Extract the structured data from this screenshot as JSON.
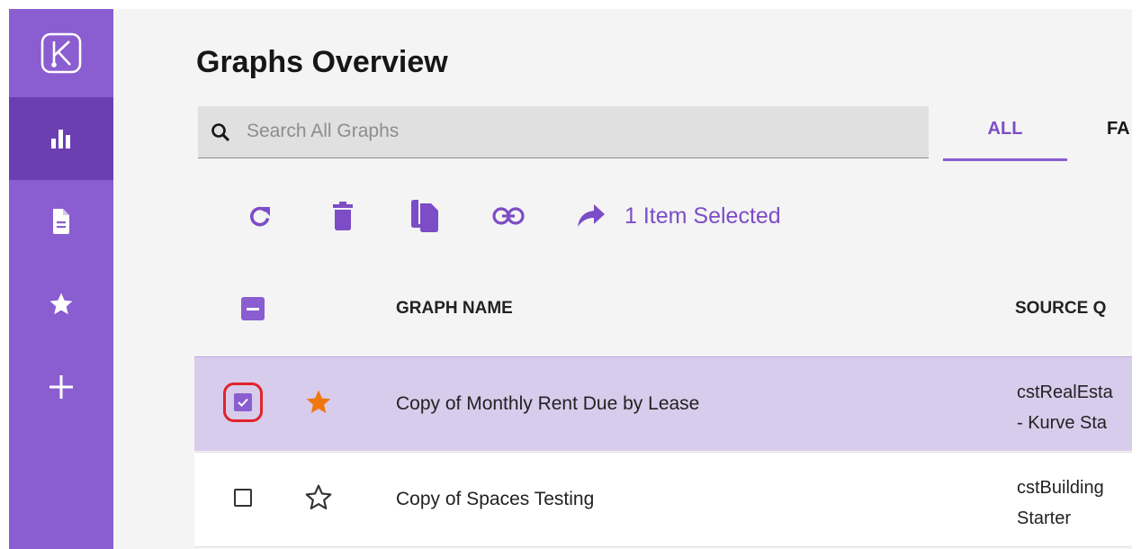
{
  "sidebar": {
    "logo_icon": "kurve-logo-icon",
    "items": [
      {
        "name": "graphs",
        "icon": "bar-chart-icon",
        "active": true
      },
      {
        "name": "documents",
        "icon": "document-icon",
        "active": false
      },
      {
        "name": "favorites",
        "icon": "star-icon",
        "active": false
      },
      {
        "name": "add",
        "icon": "plus-icon",
        "active": false
      }
    ]
  },
  "header": {
    "title": "Graphs Overview"
  },
  "search": {
    "placeholder": "Search All Graphs",
    "value": ""
  },
  "tabs": [
    {
      "label": "ALL",
      "active": true
    },
    {
      "label": "FA",
      "active": false
    }
  ],
  "toolbar": {
    "icons": [
      "refresh-icon",
      "delete-icon",
      "copy-icon",
      "link-icon",
      "share-icon"
    ],
    "selected_label": "1 Item Selected"
  },
  "table": {
    "columns": [
      "GRAPH NAME",
      "SOURCE Q"
    ],
    "rows": [
      {
        "name": "Copy of Monthly Rent Due by Lease",
        "source_line1": "cstRealEsta",
        "source_line2": "- Kurve Sta",
        "checked": true,
        "favorite": true
      },
      {
        "name": "Copy of Spaces Testing",
        "source_line1": "cstBuilding",
        "source_line2": "Starter",
        "checked": false,
        "favorite": false
      }
    ]
  },
  "colors": {
    "accent": "#8a5dd0",
    "accent_dark": "#6b3fb2",
    "selected_row": "#d8ccec",
    "favorite_star": "#f0760f",
    "highlight_ring": "#e0242a"
  }
}
